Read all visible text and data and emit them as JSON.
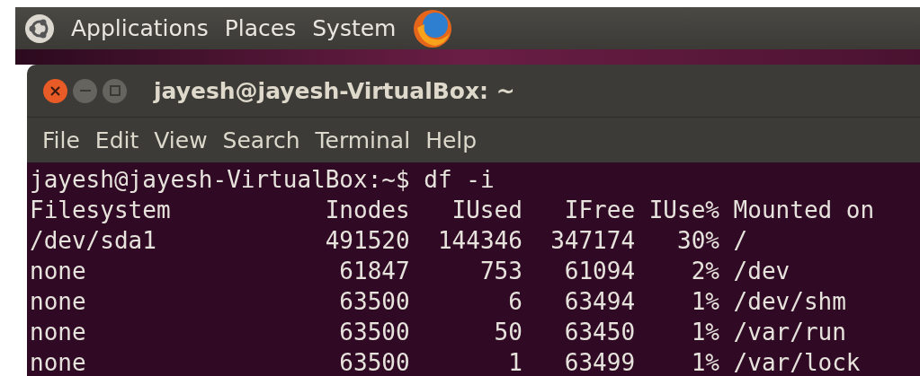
{
  "top_panel": {
    "menus": [
      "Applications",
      "Places",
      "System"
    ]
  },
  "window": {
    "title": "jayesh@jayesh-VirtualBox: ~"
  },
  "menu_bar": [
    "File",
    "Edit",
    "View",
    "Search",
    "Terminal",
    "Help"
  ],
  "terminal": {
    "prompt": "jayesh@jayesh-VirtualBox:~$ df -i",
    "columns": [
      "Filesystem",
      "Inodes",
      "IUsed",
      "IFree",
      "IUse%",
      "Mounted on"
    ],
    "rows": [
      [
        "/dev/sda1",
        "491520",
        "144346",
        "347174",
        "30%",
        "/"
      ],
      [
        "none",
        "61847",
        "753",
        "61094",
        "2%",
        "/dev"
      ],
      [
        "none",
        "63500",
        "6",
        "63494",
        "1%",
        "/dev/shm"
      ],
      [
        "none",
        "63500",
        "50",
        "63450",
        "1%",
        "/var/run"
      ],
      [
        "none",
        "63500",
        "1",
        "63499",
        "1%",
        "/var/lock"
      ]
    ]
  }
}
